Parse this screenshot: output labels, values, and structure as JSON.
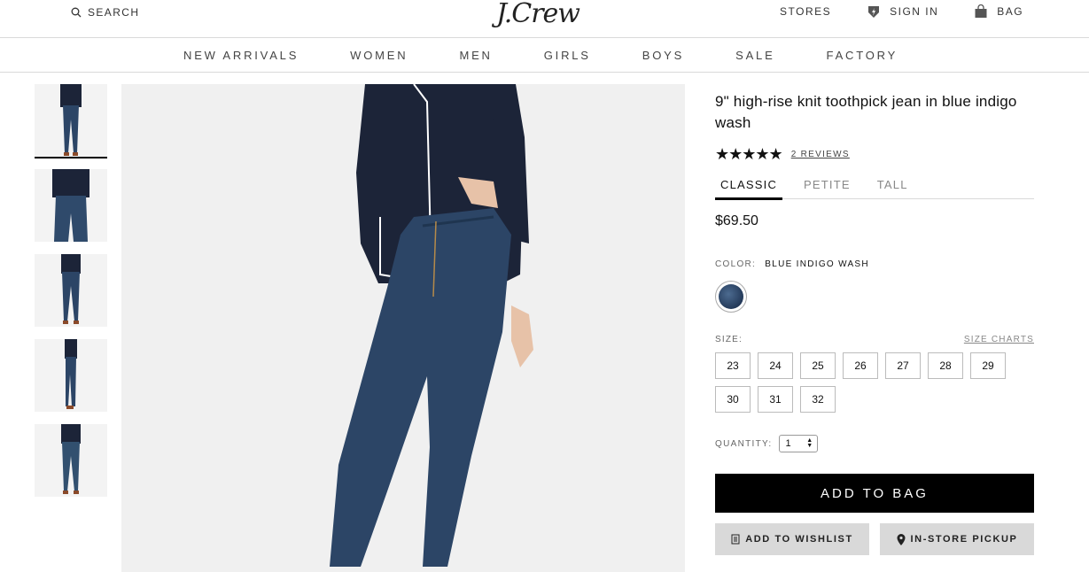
{
  "header": {
    "search_label": "SEARCH",
    "logo": "J.Crew",
    "stores_label": "STORES",
    "signin_label": "SIGN IN",
    "bag_label": "BAG"
  },
  "nav": {
    "items": [
      "NEW ARRIVALS",
      "WOMEN",
      "MEN",
      "GIRLS",
      "BOYS",
      "SALE",
      "FACTORY"
    ]
  },
  "product": {
    "title": "9\" high-rise knit toothpick jean in blue indigo wash",
    "rating_stars": "★★★★★",
    "reviews_label": "2 REVIEWS",
    "fit_tabs": [
      "CLASSIC",
      "PETITE",
      "TALL"
    ],
    "active_fit": "CLASSIC",
    "price": "$69.50",
    "color_label": "COLOR:",
    "color_value": "BLUE INDIGO WASH",
    "size_label": "SIZE:",
    "size_charts_label": "SIZE CHARTS",
    "sizes": [
      "23",
      "24",
      "25",
      "26",
      "27",
      "28",
      "29",
      "30",
      "31",
      "32"
    ],
    "quantity_label": "QUANTITY:",
    "quantity_value": "1",
    "add_to_bag": "ADD TO BAG",
    "add_to_wishlist": "ADD TO WISHLIST",
    "in_store_pickup": "IN-STORE PICKUP"
  },
  "colors": {
    "accent": "#000000",
    "secondary_button": "#d9d9d9",
    "denim": "#2c4566",
    "shirt": "#1c2438"
  }
}
